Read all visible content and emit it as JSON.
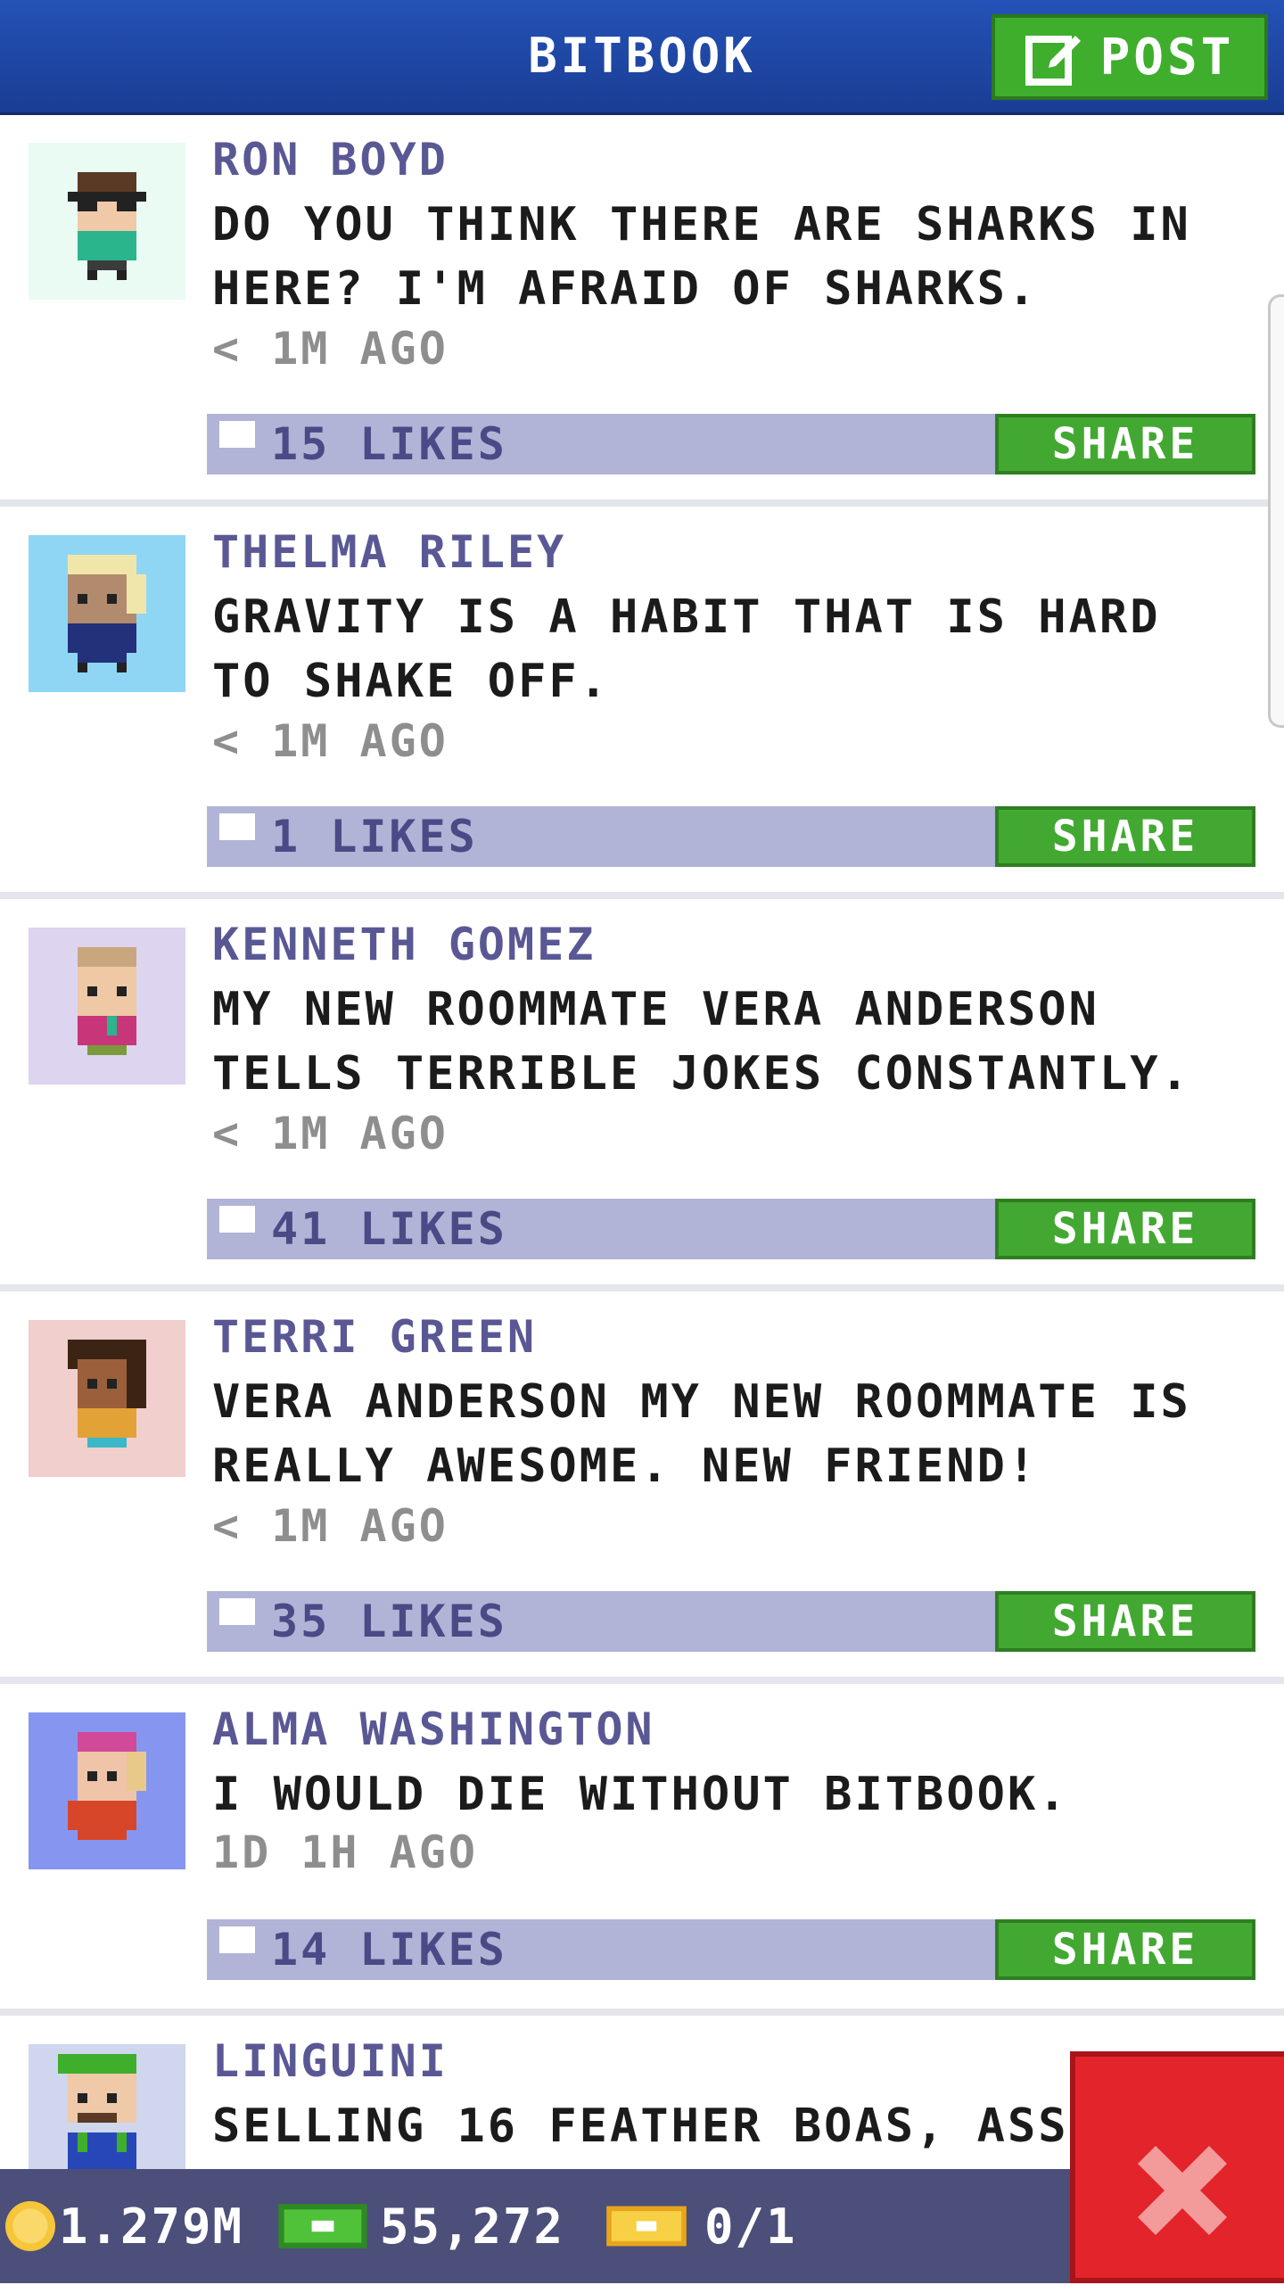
{
  "header": {
    "title": "BITBOOK",
    "post_label": "POST"
  },
  "posts": [
    {
      "name": "RON BOYD",
      "text": "DO YOU THINK THERE ARE SHARKS IN HERE? I'M AFRAID OF SHARKS.",
      "time": "< 1M AGO",
      "likes": "15 LIKES",
      "share": "SHARE",
      "avatar_bg": "#e9fbf3",
      "shirt": "#2bb58c",
      "hair": "#5a3a24",
      "skin": "#f0c9a8"
    },
    {
      "name": "THELMA RILEY",
      "text": "GRAVITY IS A HABIT THAT IS HARD TO SHAKE OFF.",
      "time": "< 1M AGO",
      "likes": "1 LIKES",
      "share": "SHARE",
      "avatar_bg": "#8fd6f5",
      "shirt": "#23307a",
      "hair": "#f1e6a9",
      "skin": "#b28a6e"
    },
    {
      "name": "KENNETH GOMEZ",
      "text": "MY NEW ROOMMATE VERA ANDERSON TELLS TERRIBLE JOKES CONSTANTLY.",
      "time": "< 1M AGO",
      "likes": "41 LIKES",
      "share": "SHARE",
      "avatar_bg": "#ddd4ef",
      "shirt": "#c8367a",
      "hair": "#c9a77e",
      "skin": "#efc8a6"
    },
    {
      "name": "TERRI GREEN",
      "text": "VERA ANDERSON MY NEW ROOMMATE IS REALLY AWESOME. NEW FRIEND!",
      "time": "< 1M AGO",
      "likes": "35 LIKES",
      "share": "SHARE",
      "avatar_bg": "#f0cfcd",
      "shirt": "#e2a236",
      "hair": "#3b2414",
      "skin": "#9b5f3c"
    },
    {
      "name": "ALMA WASHINGTON",
      "text": "I WOULD DIE WITHOUT BITBOOK.",
      "time": "1D 1H AGO",
      "likes": "14 LIKES",
      "share": "SHARE",
      "avatar_bg": "#8696f0",
      "shirt": "#d8462a",
      "hair": "#d14a9a",
      "skin": "#f0c4a8"
    },
    {
      "name": "LINGUINI",
      "text": "SELLING 16 FEATHER BOAS, ASS",
      "time": "",
      "likes": "",
      "share": "",
      "avatar_bg": "#cfd6ee",
      "shirt": "#2747b8",
      "hair": "#3fae2d",
      "skin": "#f0c9a8"
    }
  ],
  "bottom": {
    "coins": "1.279M",
    "bux": "55,272",
    "tickets": "0/1"
  },
  "colors": {
    "header": "#2452b6",
    "accent_green": "#42a832",
    "like_bar": "#b1b4d6",
    "name": "#5a5894",
    "close_red": "#e3242b"
  }
}
